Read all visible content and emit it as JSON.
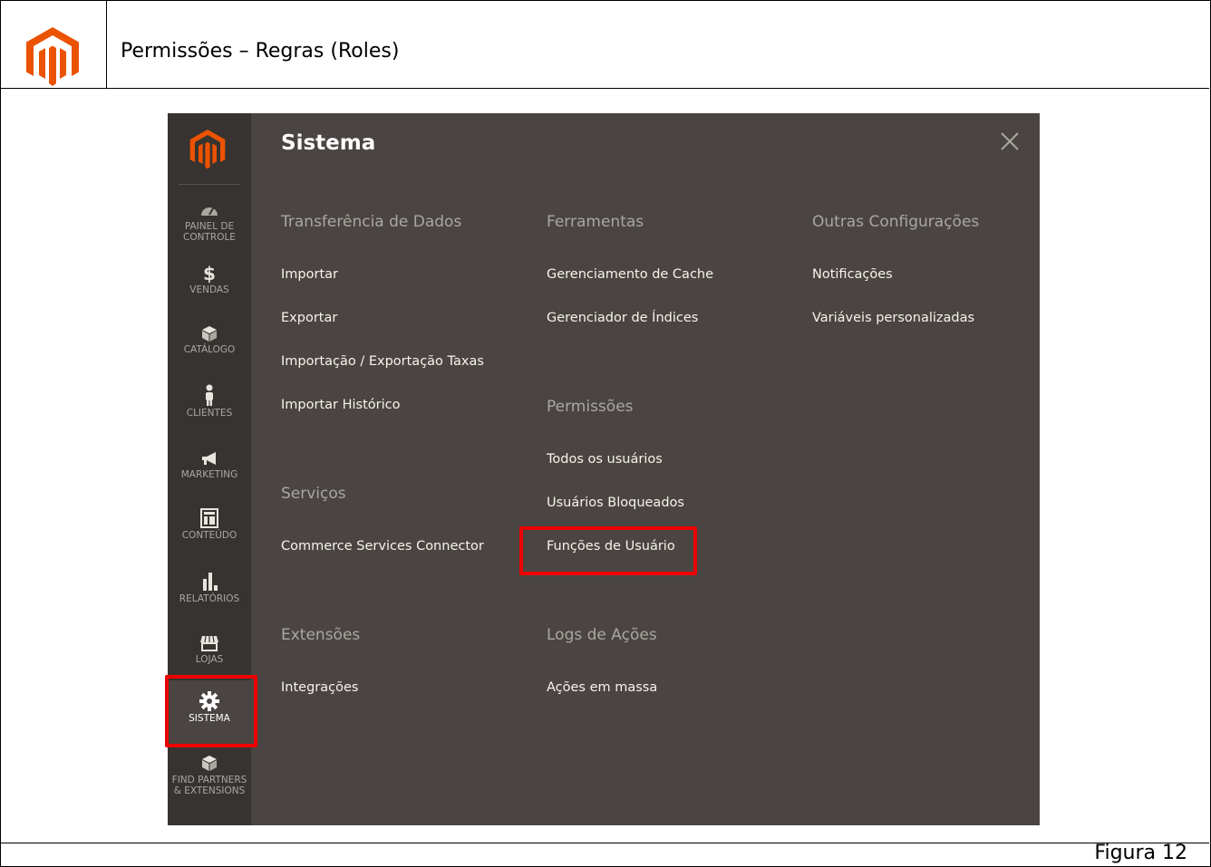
{
  "document": {
    "title": "Permissões – Regras (Roles)",
    "caption": "Figura 12"
  },
  "sidebar": {
    "items": [
      {
        "label_line1": "PAINEL DE",
        "label_line2": "CONTROLE",
        "icon": "dashboard-icon"
      },
      {
        "label_line1": "VENDAS",
        "label_line2": "",
        "icon": "dollar-icon"
      },
      {
        "label_line1": "CATÁLOGO",
        "label_line2": "",
        "icon": "box-icon"
      },
      {
        "label_line1": "CLIENTES",
        "label_line2": "",
        "icon": "person-icon"
      },
      {
        "label_line1": "MARKETING",
        "label_line2": "",
        "icon": "megaphone-icon"
      },
      {
        "label_line1": "CONTEÚDO",
        "label_line2": "",
        "icon": "layout-icon"
      },
      {
        "label_line1": "RELATÓRIOS",
        "label_line2": "",
        "icon": "bar-chart-icon"
      },
      {
        "label_line1": "LOJAS",
        "label_line2": "",
        "icon": "store-icon"
      },
      {
        "label_line1": "SISTEMA",
        "label_line2": "",
        "icon": "gear-icon"
      },
      {
        "label_line1": "FIND PARTNERS",
        "label_line2": "& EXTENSIONS",
        "icon": "blocks-icon"
      }
    ]
  },
  "panel": {
    "title": "Sistema",
    "columns": {
      "col1": {
        "section1": "Transferência de Dados",
        "section1_links": [
          "Importar",
          "Exportar",
          "Importação / Exportação Taxas",
          "Importar Histórico"
        ],
        "section2": "Serviços",
        "section2_links": [
          "Commerce Services Connector"
        ],
        "section3": "Extensões",
        "section3_links": [
          "Integrações"
        ]
      },
      "col2": {
        "section1": "Ferramentas",
        "section1_links": [
          "Gerenciamento de Cache",
          "Gerenciador de Índices"
        ],
        "section2": "Permissões",
        "section2_links": [
          "Todos os usuários",
          "Usuários Bloqueados",
          "Funções de Usuário"
        ],
        "section3": "Logs de Ações",
        "section3_links": [
          "Ações em massa"
        ]
      },
      "col3": {
        "section1": "Outras Configurações",
        "section1_links": [
          "Notificações",
          "Variáveis personalizadas"
        ]
      }
    }
  },
  "colors": {
    "rail_bg": "#373330",
    "panel_bg": "#4a4542",
    "brand_orange": "#eb5202",
    "highlight_red": "#ee0000"
  }
}
